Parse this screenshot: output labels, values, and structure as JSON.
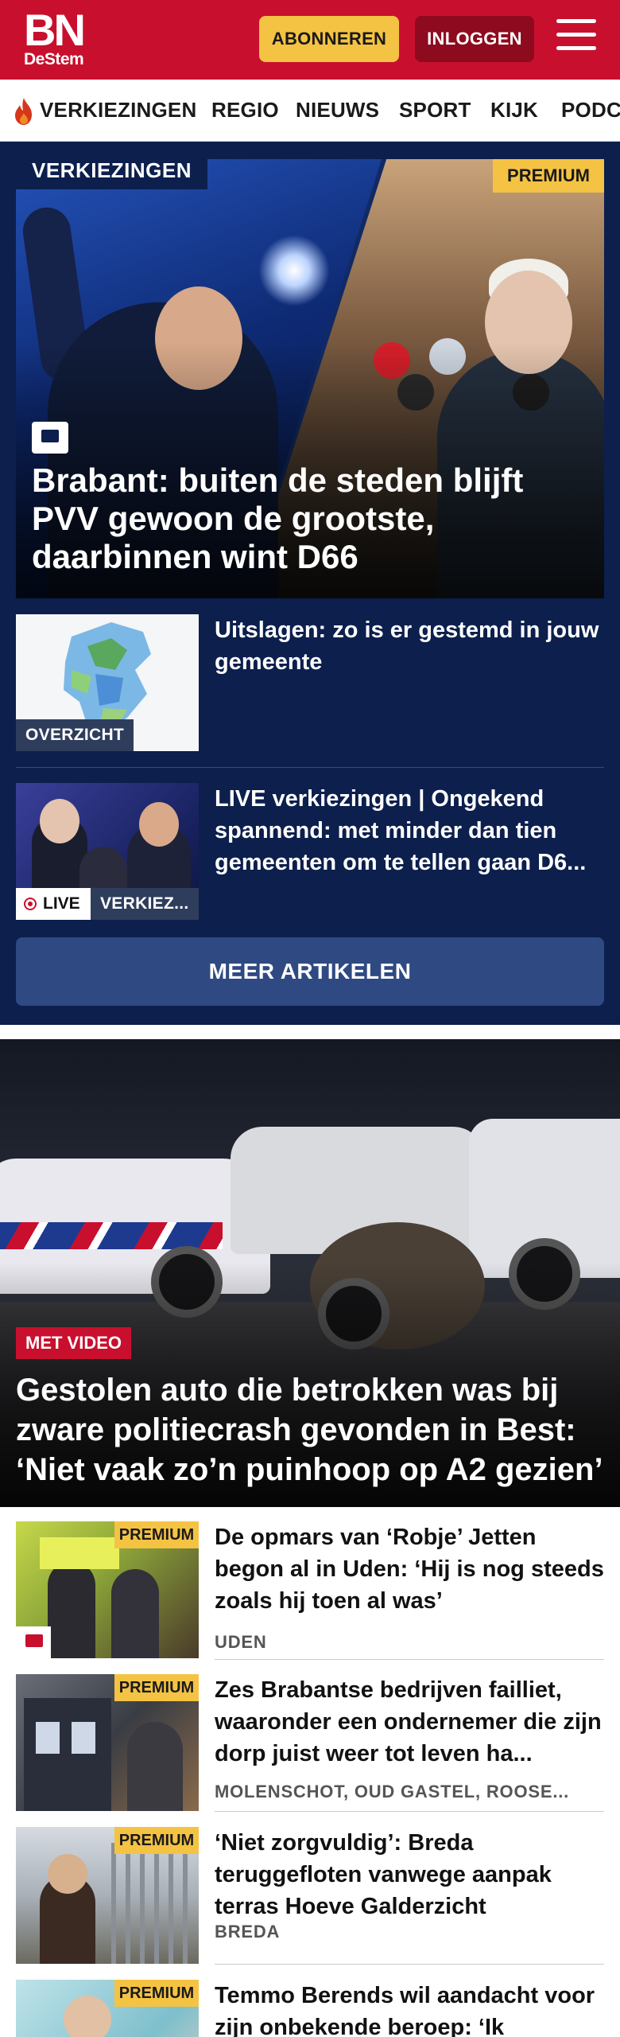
{
  "header": {
    "logo_main": "BN",
    "logo_sub": "DeStem",
    "subscribe_label": "ABONNEREN",
    "login_label": "INLOGGEN",
    "menu_icon": "hamburger-menu-icon",
    "brand_color": "#c8102e"
  },
  "nav": {
    "items": [
      "VERKIEZINGEN",
      "REGIO",
      "NIEUWS",
      "SPORT",
      "KIJK",
      "PODC"
    ],
    "active_icon": "flame-icon"
  },
  "election": {
    "topic_label": "VERKIEZINGEN",
    "premium_label": "PREMIUM",
    "hero_title": "Brabant: buiten de steden blijft PVV gewoon de grootste, daarbinnen wint D66",
    "cards": [
      {
        "title": "Uitslagen: zo is er gestemd in jouw gemeente",
        "label": "OVERZICHT"
      },
      {
        "title": "LIVE verkiezingen | Ongekend spannend: met minder dan tien gemeenten om te tellen gaan D6...",
        "live_label": "LIVE",
        "label": "VERKIEZ..."
      }
    ],
    "more_button": "MEER ARTIKELEN",
    "background_color": "#0c1f4d"
  },
  "crash": {
    "tag": "MET VIDEO",
    "title": "Gestolen auto die betrokken was bij zware politiecrash gevonden in Best: ‘Niet vaak zo’n puinhoop op A2 gezien’"
  },
  "articles": [
    {
      "title": "De opmars van ‘Robje’ Jetten begon al in Uden: ‘Hij is nog steeds zoals hij toen al was’",
      "place": "UDEN",
      "premium": "PREMIUM"
    },
    {
      "title": "Zes Brabantse bedrijven failliet, waaronder een ondernemer die zijn dorp juist weer tot leven ha...",
      "place": "MOLENSCHOT, OUD GASTEL, ROOSE...",
      "premium": "PREMIUM"
    },
    {
      "title": "‘Niet zorgvuldig’: Breda teruggefloten vanwege aanpak terras Hoeve Galderzicht",
      "place": "BREDA",
      "premium": "PREMIUM"
    },
    {
      "title": "Temmo Berends wil aandacht voor zijn onbekende beroep: ‘Ik",
      "place": "",
      "premium": "PREMIUM"
    }
  ]
}
